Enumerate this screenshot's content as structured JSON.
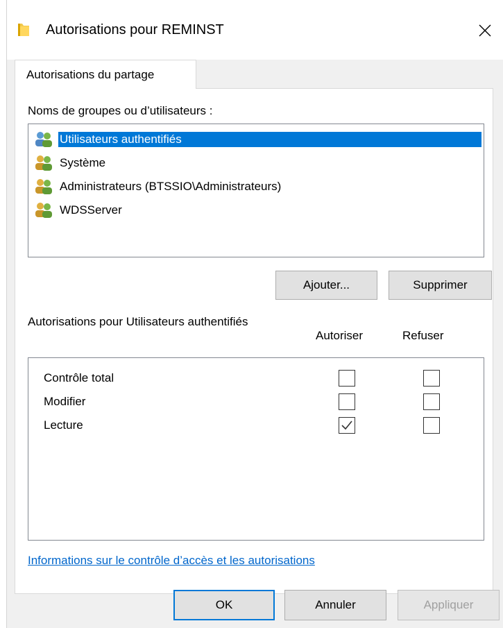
{
  "window": {
    "title": "Autorisations pour REMINST",
    "close_symbol": "✕"
  },
  "tab": {
    "label": "Autorisations du partage"
  },
  "groups": {
    "label": "Noms de groupes ou d’utilisateurs :",
    "items": [
      {
        "label": "Utilisateurs authentifiés",
        "icon": "users-group-icon",
        "selected": true
      },
      {
        "label": "Système",
        "icon": "users-group-icon",
        "selected": false
      },
      {
        "label": "Administrateurs (BTSSIO\\Administrateurs)",
        "icon": "users-group-icon",
        "selected": false
      },
      {
        "label": "WDSServer",
        "icon": "users-group-icon",
        "selected": false
      }
    ],
    "add_label": "Ajouter...",
    "remove_label": "Supprimer"
  },
  "permissions": {
    "label": "Autorisations pour Utilisateurs authentifiés",
    "allow_header": "Autoriser",
    "deny_header": "Refuser",
    "rows": [
      {
        "name": "Contrôle total",
        "allow": false,
        "deny": false
      },
      {
        "name": "Modifier",
        "allow": false,
        "deny": false
      },
      {
        "name": "Lecture",
        "allow": true,
        "deny": false
      }
    ]
  },
  "info_link": "Informations sur le contrôle d’accès et les autorisations",
  "buttons": {
    "ok": "OK",
    "cancel": "Annuler",
    "apply": "Appliquer"
  },
  "colors": {
    "selection": "#0078d7",
    "link": "#0066cc",
    "folder": "#f2c94c"
  }
}
